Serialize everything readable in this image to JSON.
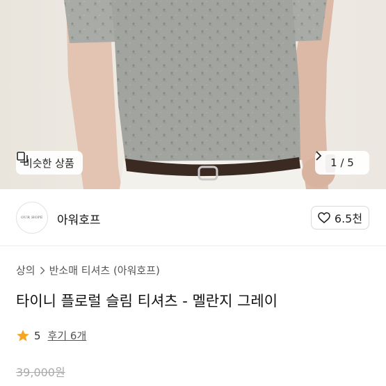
{
  "gallery": {
    "similar_label": "비슷한 상품",
    "counter": "1 / 5",
    "icons": {
      "similar": "copy-icon",
      "next": "chevron-right-icon"
    }
  },
  "shop": {
    "logo_text": "OUR HOPE",
    "name": "아워호프",
    "like_count": "6.5천",
    "like_icon": "heart-outline-icon"
  },
  "product": {
    "breadcrumb": [
      "상의",
      "반소매 티셔츠 (아워호프)"
    ],
    "title": "타이니 플로럴 슬림 티셔츠 - 멜란지 그레이",
    "rating": "5",
    "reviews": "후기 6개",
    "original_price": "39,000원"
  },
  "colors": {
    "star": "#f5a623",
    "accent_text": "#222222"
  }
}
